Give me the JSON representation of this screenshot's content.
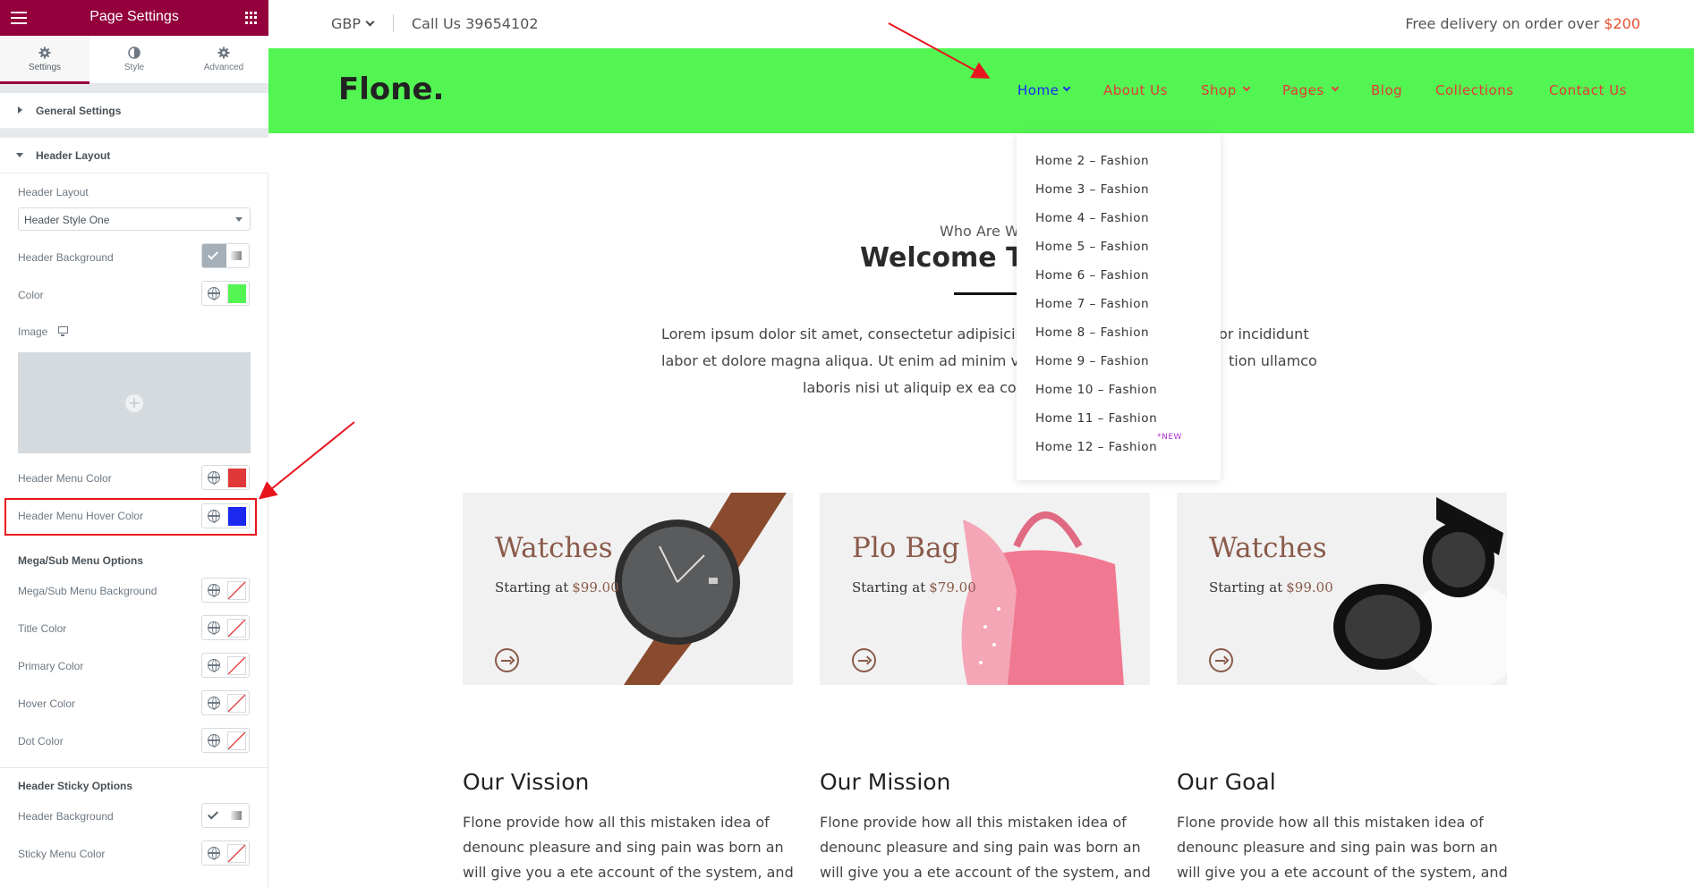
{
  "panel": {
    "title": "Page Settings",
    "tabs": [
      {
        "label": "Settings",
        "icon": "gear-icon",
        "active": true
      },
      {
        "label": "Style",
        "icon": "half-circle-icon",
        "active": false
      },
      {
        "label": "Advanced",
        "icon": "gear-icon",
        "active": false
      }
    ],
    "sections": {
      "general": "General Settings",
      "header_layout": "Header Layout"
    },
    "controls": {
      "header_layout_label": "Header Layout",
      "header_layout_value": "Header Style One",
      "header_background": "Header Background",
      "color": "Color",
      "color_value": "#52f552",
      "image": "Image",
      "header_menu_color": "Header Menu Color",
      "header_menu_color_value": "#e03838",
      "header_menu_hover_color": "Header Menu Hover Color",
      "header_menu_hover_color_value": "#1a28f0",
      "mega_sub_menu_options": "Mega/Sub Menu Options",
      "mega_sub_menu_background": "Mega/Sub Menu Background",
      "title_color": "Title Color",
      "primary_color": "Primary Color",
      "hover_color": "Hover Color",
      "dot_color": "Dot Color",
      "header_sticky_options": "Header Sticky Options",
      "sticky_header_background": "Header Background",
      "sticky_menu_color": "Sticky Menu Color"
    }
  },
  "site": {
    "topbar": {
      "currency": "GBP",
      "call": "Call Us 39654102",
      "free_delivery": "Free delivery on order over",
      "free_amount": "$200"
    },
    "logo": "Flone.",
    "nav": [
      {
        "label": "Home",
        "has_dropdown": true,
        "hover": true
      },
      {
        "label": "About Us",
        "has_dropdown": false
      },
      {
        "label": "Shop",
        "has_dropdown": true
      },
      {
        "label": "Pages",
        "has_dropdown": true
      },
      {
        "label": "Blog",
        "has_dropdown": false
      },
      {
        "label": "Collections",
        "has_dropdown": false
      },
      {
        "label": "Contact Us",
        "has_dropdown": false
      }
    ],
    "home_dropdown": [
      "Home 2 – Fashion",
      "Home 3 – Fashion",
      "Home 4 – Fashion",
      "Home 5 – Fashion",
      "Home 6 – Fashion",
      "Home 7 – Fashion",
      "Home 8 – Fashion",
      "Home 9 – Fashion",
      "Home 10 – Fashion",
      "Home 11 – Fashion",
      "Home 12 – Fashion"
    ],
    "home_dropdown_new_badge": "*NEW",
    "who_are": "Who Are W",
    "welcome": "Welcome To",
    "lorem_lines": [
      {
        "left": "Lorem ipsum dolor sit amet, consectetur adipisicin",
        "right": "or incididunt"
      },
      {
        "left": "labor et dolore magna aliqua. Ut enim ad minim v",
        "right": "tion ullamco"
      },
      {
        "left": "laboris nisi ut aliquip ex ea cor",
        "right": ""
      }
    ],
    "cards": [
      {
        "title": "Watches",
        "starting": "Starting at",
        "price": "$99.00"
      },
      {
        "title": "Plo Bag",
        "starting": "Starting at",
        "price": "$79.00"
      },
      {
        "title": "Watches",
        "starting": "Starting at",
        "price": "$99.00"
      }
    ],
    "features": [
      {
        "title": "Our Vission",
        "lines": [
          "Flone provide how all this mistaken idea of",
          "denounc pleasure and sing pain was born an",
          "will give you a ete account of the system, and"
        ]
      },
      {
        "title": "Our Mission",
        "lines": [
          "Flone provide how all this mistaken idea of",
          "denounc pleasure and sing pain was born an",
          "will give you a ete account of the system, and"
        ]
      },
      {
        "title": "Our Goal",
        "lines": [
          "Flone provide how all this mistaken idea of",
          "denounc pleasure and sing pain was born an",
          "will give you a ete account of the system, and"
        ]
      }
    ]
  }
}
